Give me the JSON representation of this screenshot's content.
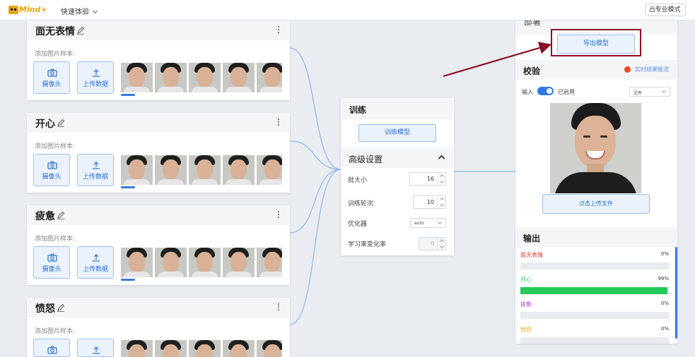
{
  "app": {
    "logo_text": "Mind+",
    "mode_menu_label": "快速体验",
    "pro_mode_label": "专业模式",
    "lock_icon": "lock-icon"
  },
  "classes": {
    "add_sample_label": "添加图片样本:",
    "webcam_label": "摄像头",
    "upload_label": "上传数据",
    "items": [
      {
        "name": "面无表情"
      },
      {
        "name": "开心"
      },
      {
        "name": "疲惫"
      },
      {
        "name": "愤怒"
      }
    ]
  },
  "training": {
    "title": "训练",
    "train_button": "训练模型",
    "advanced_title": "高级设置",
    "batch_label": "批大小",
    "batch_value": "16",
    "epochs_label": "训练轮次",
    "epochs_value": "10",
    "optimizer_label": "优化器",
    "optimizer_value": "auto",
    "lr_label": "学习率变化率",
    "lr_value": "0"
  },
  "deploy": {
    "title": "部署",
    "export_button": "导出模型"
  },
  "verify": {
    "title": "校验",
    "realtime_label": "实时结果推送",
    "input_label": "输入",
    "enabled_label": "已启用",
    "source_select": "文件",
    "upload_file_button": "点击上传文件"
  },
  "output": {
    "title": "输出",
    "rows": [
      {
        "name": "面无表情",
        "pct": "0%",
        "value": 0,
        "color": "#e0433a"
      },
      {
        "name": "开心",
        "pct": "99%",
        "value": 99,
        "color": "#27c95a"
      },
      {
        "name": "疲惫",
        "pct": "0%",
        "value": 0,
        "color": "#a548d8"
      },
      {
        "name": "愤怒",
        "pct": "0%",
        "value": 0,
        "color": "#e3b021"
      }
    ]
  },
  "colors": {
    "accent": "#2d6fcf",
    "highlight": "#8b0d22",
    "connector": "#8fb8ea"
  }
}
